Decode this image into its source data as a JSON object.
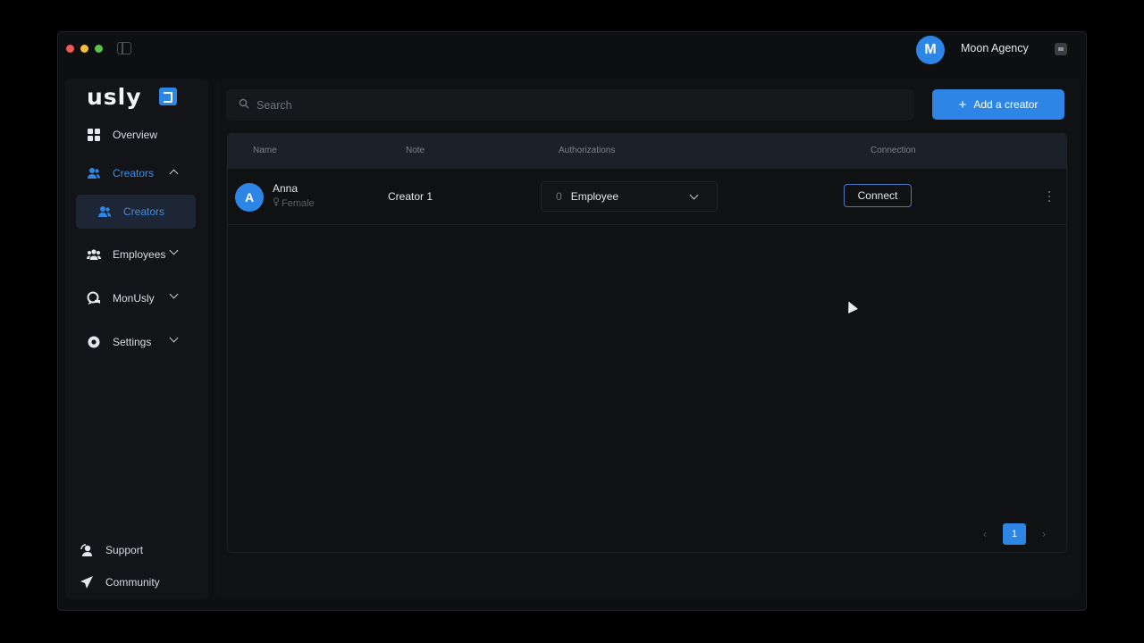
{
  "window": {
    "traffic_lights": [
      "#ee5b55",
      "#f5bd3c",
      "#5dc24b"
    ]
  },
  "topbar": {
    "avatar_initial": "M",
    "agency_name": "Moon Agency"
  },
  "sidebar": {
    "logo_text": "usly",
    "items": [
      {
        "label": "Overview",
        "icon": "grid-icon"
      },
      {
        "label": "Creators",
        "icon": "users-icon",
        "expanded": true
      },
      {
        "label": "Creators",
        "icon": "users-icon",
        "active": true
      },
      {
        "label": "Employees",
        "icon": "team-icon"
      },
      {
        "label": "MonUsly",
        "icon": "chat-icon"
      },
      {
        "label": "Settings",
        "icon": "gear-icon"
      }
    ],
    "bottom": [
      {
        "label": "Support",
        "icon": "support-icon"
      },
      {
        "label": "Community",
        "icon": "send-icon"
      }
    ]
  },
  "main": {
    "search_placeholder": "Search",
    "add_button_label": "Add a creator",
    "table": {
      "headers": [
        "Name",
        "Note",
        "Authorizations",
        "Connection"
      ],
      "rows": [
        {
          "avatar_initial": "A",
          "name": "Anna",
          "gender": "Female",
          "note": "Creator 1",
          "auth_count": "0",
          "auth_role": "Employee",
          "connection_label": "Connect"
        }
      ]
    },
    "pagination": {
      "current_page": "1",
      "prev": "‹",
      "next": "›"
    }
  },
  "colors": {
    "accent": "#2d86e6",
    "background": "#0d0f11"
  }
}
